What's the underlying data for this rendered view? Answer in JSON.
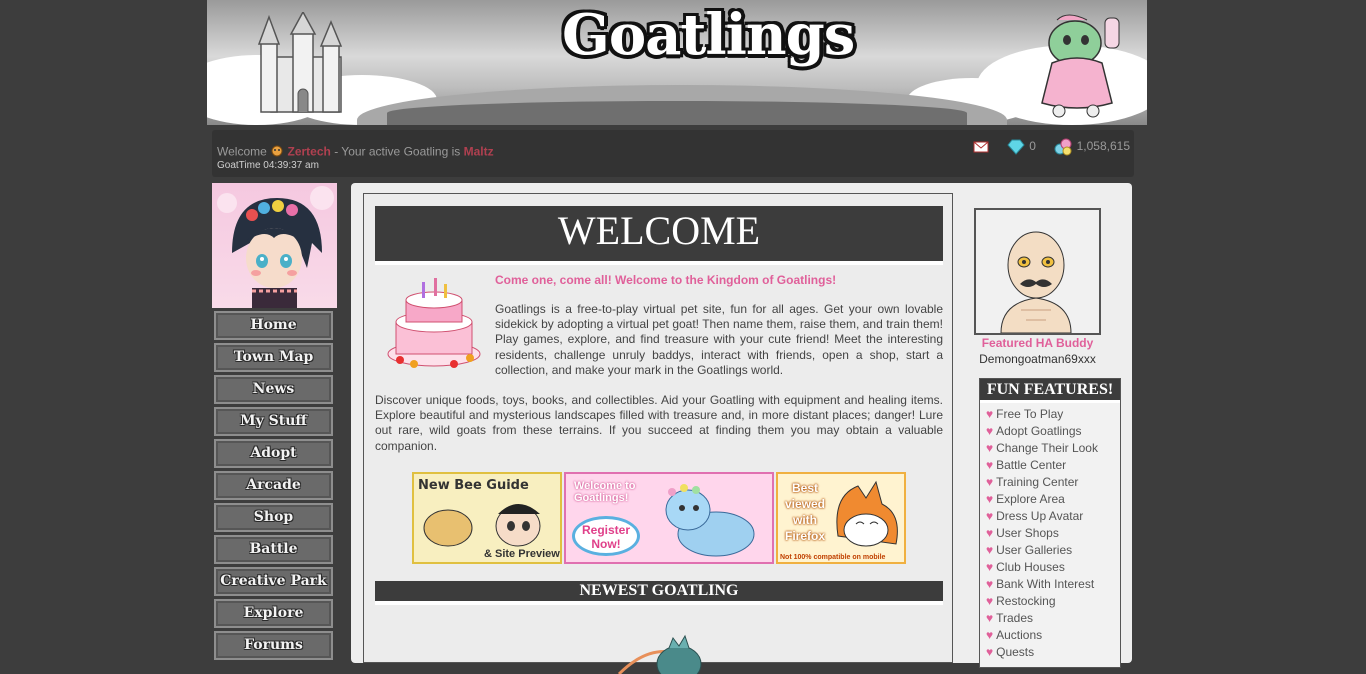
{
  "header": {
    "logo_text": "Goatlings"
  },
  "userbar": {
    "welcome_prefix": "Welcome",
    "username": "Zertech",
    "active_text": "- Your active Goatling is",
    "active_goatling": "Maltz",
    "goattime": "GoatTime 04:39:37 am",
    "gems": "0",
    "currency": "1,058,615",
    "icons": [
      "mail-icon",
      "gem-icon",
      "currency-icon"
    ]
  },
  "nav": {
    "items": [
      "Home",
      "Town Map",
      "News",
      "My Stuff",
      "Adopt",
      "Arcade",
      "Shop",
      "Battle",
      "Creative Park",
      "Explore",
      "Forums"
    ]
  },
  "main": {
    "welcome_heading": "WELCOME",
    "intro_title": "Come one, come all! Welcome to the Kingdom of Goatlings!",
    "intro_text": "Goatlings is a free-to-play virtual pet site, fun for all ages. Get your own lovable sidekick by adopting a virtual pet goat! Then name them, raise them, and train them! Play games, explore, and find treasure with your cute friend! Meet the interesting residents, challenge unruly baddys, interact with friends, open a shop, start a collection, and make your mark in the Goatlings world.",
    "discover_text": "Discover unique foods, toys, books, and collectibles. Aid your Goatling with equipment and healing items. Explore beautiful and mysterious landscapes filled with treasure and, in more distant places; danger! Lure out rare, wild goats from these terrains. If you succeed at finding them you may obtain a valuable companion.",
    "banners": {
      "guide_line1": "New Bee Guide",
      "guide_line2": "& Site Preview",
      "register_top": "Welcome to Goatlings!",
      "register_button": "Register Now!",
      "firefox_text": "Best viewed with Firefox",
      "firefox_note": "Not 100% compatible on mobile"
    },
    "newest_heading": "NEWEST GOATLING"
  },
  "sidebar": {
    "buddy_label": "Featured HA Buddy",
    "buddy_name": "Demongoatman69xxx",
    "fun_heading": "FUN FEATURES!",
    "fun_items": [
      "Free To Play",
      "Adopt Goatlings",
      "Change Their Look",
      "Battle Center",
      "Training Center",
      "Explore Area",
      "Dress Up Avatar",
      "User Shops",
      "User Galleries",
      "Club Houses",
      "Bank With Interest",
      "Restocking",
      "Trades",
      "Auctions",
      "Quests"
    ]
  },
  "colors": {
    "page_bg": "#3d3d3d",
    "panel_bg": "#eeeeee",
    "accent_pink": "#e0609a",
    "username_red": "#b04050",
    "heading_bg": "#3c3c3c"
  }
}
